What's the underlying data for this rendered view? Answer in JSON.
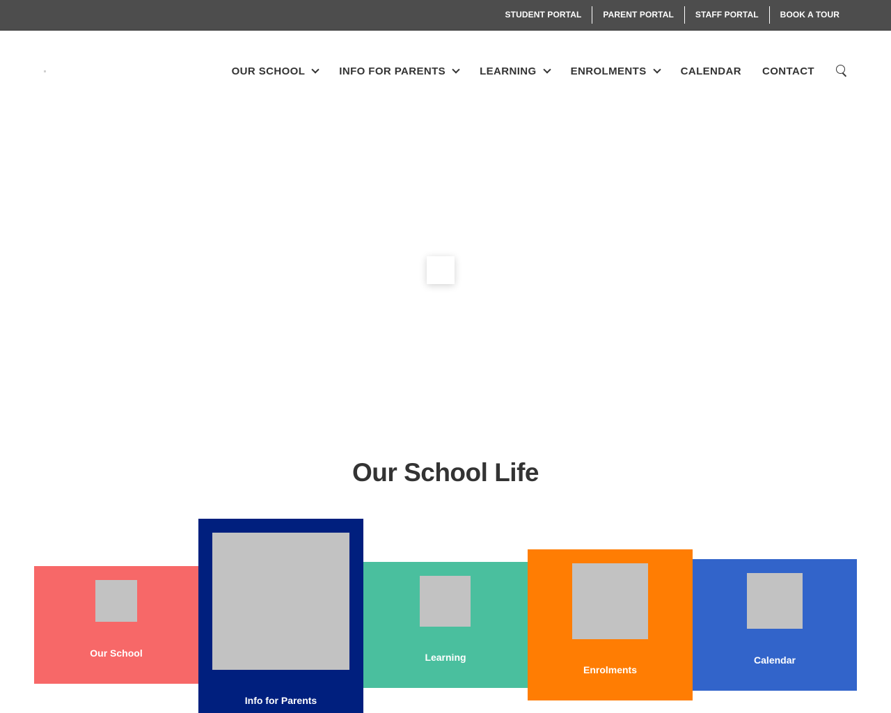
{
  "topbar": {
    "links": [
      "STUDENT PORTAL",
      "PARENT PORTAL",
      "STAFF PORTAL",
      "BOOK A TOUR"
    ]
  },
  "nav": {
    "items": [
      {
        "label": "OUR SCHOOL",
        "has_dropdown": true
      },
      {
        "label": "INFO FOR PARENTS",
        "has_dropdown": true
      },
      {
        "label": "LEARNING",
        "has_dropdown": true
      },
      {
        "label": "ENROLMENTS",
        "has_dropdown": true
      },
      {
        "label": "CALENDAR",
        "has_dropdown": false
      },
      {
        "label": "CONTACT",
        "has_dropdown": false
      }
    ],
    "search_icon": "search-icon"
  },
  "section": {
    "title": "Our School Life"
  },
  "tiles": [
    {
      "label": "Our School",
      "color": "#f76868"
    },
    {
      "label": "Info for Parents",
      "color": "#001f7e"
    },
    {
      "label": "Learning",
      "color": "#4abf9e"
    },
    {
      "label": "Enrolments",
      "color": "#ff7d03"
    },
    {
      "label": "Calendar",
      "color": "#3264ca"
    }
  ],
  "colors": {
    "topbar_bg": "#4d4d4d",
    "text_dark": "#333333",
    "placeholder": "#c2c2c2"
  }
}
